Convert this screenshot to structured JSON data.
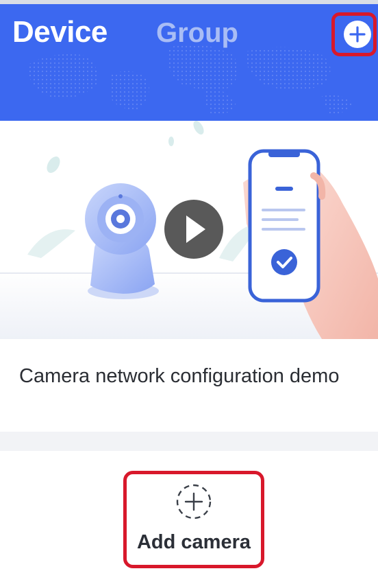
{
  "header": {
    "tabs": [
      {
        "label": "Device",
        "active": true
      },
      {
        "label": "Group",
        "active": false
      }
    ],
    "add_icon": "plus-circle-icon",
    "background_color": "#3c68f0"
  },
  "demo_card": {
    "title": "Camera network configuration demo",
    "illustration_icons": [
      "camera-icon",
      "play-icon",
      "phone-icon",
      "check-icon"
    ]
  },
  "add_camera": {
    "label": "Add camera",
    "icon": "dashed-plus-icon"
  },
  "highlight_color": "#d8182b"
}
